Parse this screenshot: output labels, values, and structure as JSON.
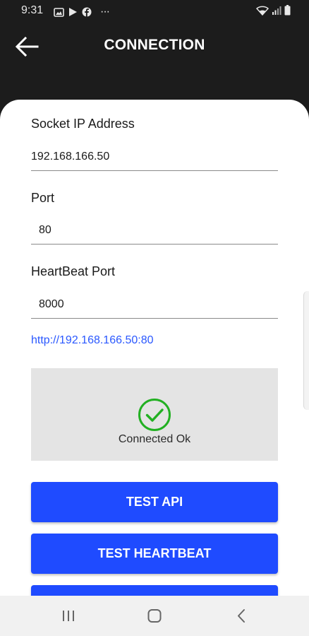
{
  "status_bar": {
    "time": "9:31",
    "left_icons": [
      "gallery-icon",
      "play-store-icon",
      "facebook-icon",
      "more-dots-icon"
    ],
    "right_icons": [
      "wifi-icon",
      "signal-icon",
      "battery-icon"
    ],
    "more_dots": "···"
  },
  "app_bar": {
    "title": "CONNECTION",
    "back_icon": "back-arrow-icon"
  },
  "form": {
    "socket_ip": {
      "label": "Socket IP Address",
      "value": "192.168.166.50"
    },
    "port": {
      "label": "Port",
      "value": "80"
    },
    "heartbeat_port": {
      "label": "HeartBeat Port",
      "value": "8000"
    }
  },
  "url": "http://192.168.166.50:80",
  "connection_status": {
    "text": "Connected Ok",
    "icon": "check-circle-icon",
    "color": "#22b022"
  },
  "buttons": {
    "test_api": "TEST API",
    "test_heartbeat": "TEST HEARTBEAT"
  },
  "colors": {
    "accent": "#1f4bff",
    "link": "#2a58ff",
    "header_bg": "#1c1c1c",
    "status_panel_bg": "#e4e4e4"
  },
  "nav_bar": {
    "items": [
      "recent-apps-icon",
      "home-icon",
      "back-icon"
    ]
  }
}
